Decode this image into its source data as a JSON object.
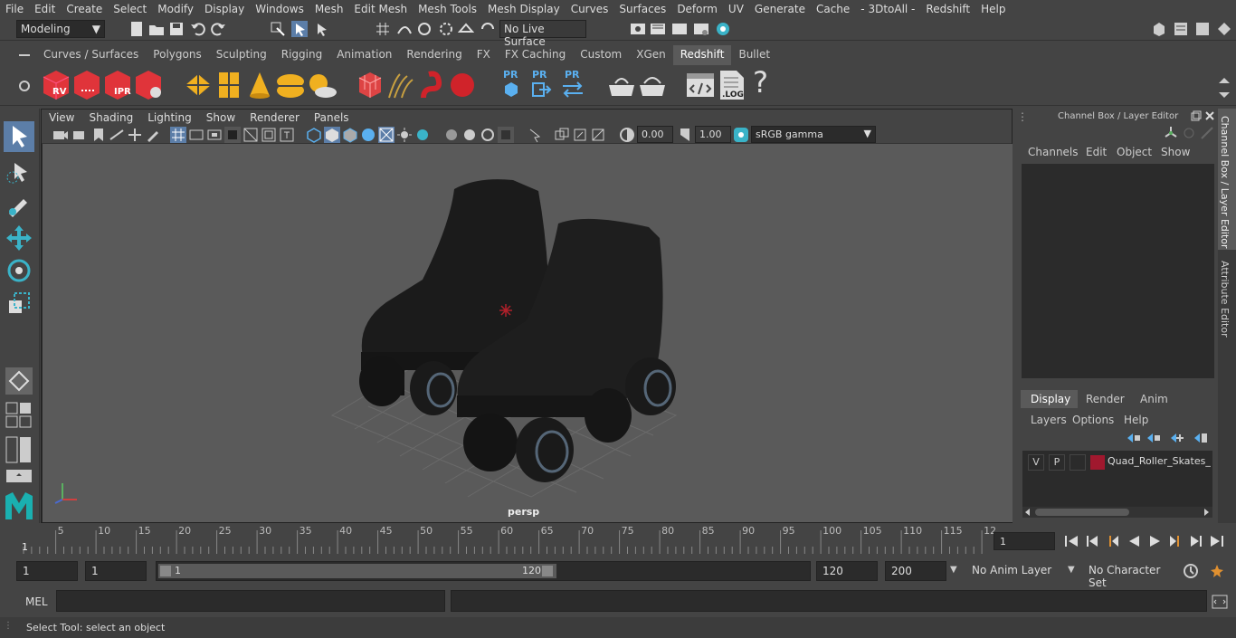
{
  "menu": [
    "File",
    "Edit",
    "Create",
    "Select",
    "Modify",
    "Display",
    "Windows",
    "Mesh",
    "Edit Mesh",
    "Mesh Tools",
    "Mesh Display",
    "Curves",
    "Surfaces",
    "Deform",
    "UV",
    "Generate",
    "Cache",
    "- 3DtoAll -",
    "Redshift",
    "Help"
  ],
  "workspace": "Modeling",
  "live_surface": "No Live Surface",
  "shelf_tabs": [
    "Curves / Surfaces",
    "Polygons",
    "Sculpting",
    "Rigging",
    "Animation",
    "Rendering",
    "FX",
    "FX Caching",
    "Custom",
    "XGen",
    "Redshift",
    "Bullet"
  ],
  "active_shelf": "Redshift",
  "shelf_labels": {
    "rv": "RV",
    "ipr": "IPR",
    "pr": "PR",
    "log": ".LOG",
    "help": "?"
  },
  "viewport": {
    "menu": [
      "View",
      "Shading",
      "Lighting",
      "Show",
      "Renderer",
      "Panels"
    ],
    "exposure": "0.00",
    "gamma": "1.00",
    "color_space": "sRGB gamma",
    "camera": "persp"
  },
  "channel_box": {
    "title": "Channel Box / Layer Editor",
    "menu": [
      "Channels",
      "Edit",
      "Object",
      "Show"
    ]
  },
  "layer_editor": {
    "tabs": [
      "Display",
      "Render",
      "Anim"
    ],
    "menu": [
      "Layers",
      "Options",
      "Help"
    ],
    "layer": {
      "v": "V",
      "p": "P",
      "name": "Quad_Roller_Skates_Bl",
      "color": "#a0182e"
    }
  },
  "side_tabs": [
    "Channel Box / Layer Editor",
    "Attribute Editor"
  ],
  "timeline": {
    "ticks": [
      "5",
      "10",
      "15",
      "20",
      "25",
      "30",
      "35",
      "40",
      "45",
      "50",
      "55",
      "60",
      "65",
      "70",
      "75",
      "80",
      "85",
      "90",
      "95",
      "100",
      "105",
      "110",
      "115",
      "12"
    ],
    "start_label": "1",
    "current_frame": "1"
  },
  "range": {
    "start": "1",
    "playback_start": "1",
    "slider_start": "1",
    "slider_end": "120",
    "playback_end": "120",
    "end": "200",
    "anim_layer": "No Anim Layer",
    "character_set": "No Character Set"
  },
  "cmd": {
    "lang": "MEL"
  },
  "help_text": "Select Tool: select an object"
}
